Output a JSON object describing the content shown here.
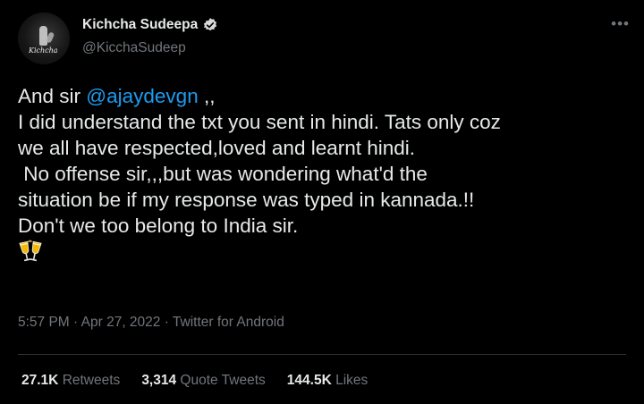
{
  "author": {
    "display_name": "Kichcha Sudeepa",
    "handle": "@KicchaSudeep",
    "avatar_signature": "Kichcha",
    "verified": true
  },
  "tweet": {
    "intro": "And sir ",
    "mention": "@ajaydevgn",
    "intro_tail": " ,,",
    "lines": [
      "I did understand the txt you sent in hindi. Tats only coz",
      "we all have respected,loved and learnt hindi.",
      " No offense sir,,,but was wondering what'd the",
      "situation be if my response was typed in kannada.!!",
      "Don't we too belong to India sir."
    ],
    "emoji": "clinking-glasses"
  },
  "meta": {
    "time": "5:57 PM",
    "date": "Apr 27, 2022",
    "source": "Twitter for Android",
    "separator": " · "
  },
  "stats": {
    "retweets": "27.1K",
    "retweets_label": "Retweets",
    "quotes": "3,314",
    "quotes_label": "Quote Tweets",
    "likes": "144.5K",
    "likes_label": "Likes"
  },
  "colors": {
    "background": "#000000",
    "text": "#e7e9ea",
    "secondary": "#71767b",
    "link": "#1d9bf0",
    "verified": "#d9d9d9"
  },
  "icons": {
    "more": "more-horizontal-icon",
    "verified": "verified-badge-icon"
  }
}
